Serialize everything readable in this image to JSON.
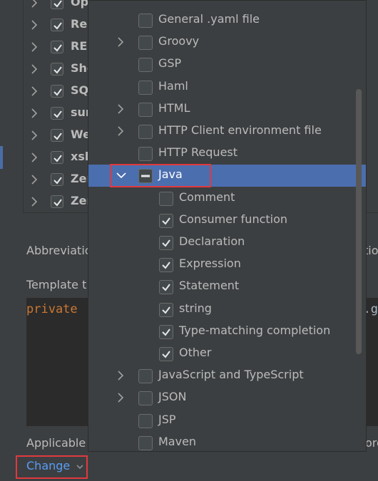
{
  "background": {
    "tree_items": [
      {
        "label": "OpenAPI Specifications (.yaml)"
      },
      {
        "label": "Rea"
      },
      {
        "label": "RES"
      },
      {
        "label": "Sho"
      },
      {
        "label": "SQ"
      },
      {
        "label": "sur"
      },
      {
        "label": "We"
      },
      {
        "label": "xsl"
      },
      {
        "label": "Zer"
      },
      {
        "label": "Zer"
      }
    ],
    "abbreviation_label": "Abbreviatio",
    "abbreviation_right": "tio",
    "template_label": "Template t",
    "template_code": "private",
    "template_code_right": ".g",
    "applicable_label": "Applicable",
    "applicable_right": "ore",
    "change_link": "Change"
  },
  "popup": {
    "items": [
      {
        "label": "General .yaml file",
        "expandable": false,
        "checked": false,
        "indent": 0
      },
      {
        "label": "Groovy",
        "expandable": true,
        "checked": false,
        "indent": 0
      },
      {
        "label": "GSP",
        "expandable": false,
        "checked": false,
        "indent": 0
      },
      {
        "label": "Haml",
        "expandable": false,
        "checked": false,
        "indent": 0
      },
      {
        "label": "HTML",
        "expandable": true,
        "checked": false,
        "indent": 0
      },
      {
        "label": "HTTP Client environment file",
        "expandable": true,
        "checked": false,
        "indent": 0
      },
      {
        "label": "HTTP Request",
        "expandable": false,
        "checked": false,
        "indent": 0
      },
      {
        "label": "Java",
        "expandable": true,
        "expanded": true,
        "checked": "partial",
        "indent": 0,
        "selected": true
      },
      {
        "label": "Comment",
        "expandable": false,
        "checked": false,
        "indent": 1
      },
      {
        "label": "Consumer function",
        "expandable": false,
        "checked": true,
        "indent": 1
      },
      {
        "label": "Declaration",
        "expandable": false,
        "checked": true,
        "indent": 1
      },
      {
        "label": "Expression",
        "expandable": false,
        "checked": true,
        "indent": 1
      },
      {
        "label": "Statement",
        "expandable": false,
        "checked": true,
        "indent": 1
      },
      {
        "label": "string",
        "expandable": false,
        "checked": true,
        "indent": 1
      },
      {
        "label": "Type-matching completion",
        "expandable": false,
        "checked": true,
        "indent": 1
      },
      {
        "label": "Other",
        "expandable": false,
        "checked": true,
        "indent": 1
      },
      {
        "label": "JavaScript and TypeScript",
        "expandable": true,
        "checked": false,
        "indent": 0
      },
      {
        "label": "JSON",
        "expandable": true,
        "checked": false,
        "indent": 0
      },
      {
        "label": "JSP",
        "expandable": false,
        "checked": false,
        "indent": 0
      },
      {
        "label": "Maven",
        "expandable": false,
        "checked": false,
        "indent": 0
      }
    ]
  },
  "colors": {
    "selection": "#4b6eaf",
    "link": "#589df6",
    "highlight_border": "#e0393e",
    "keyword": "#cc7832"
  }
}
